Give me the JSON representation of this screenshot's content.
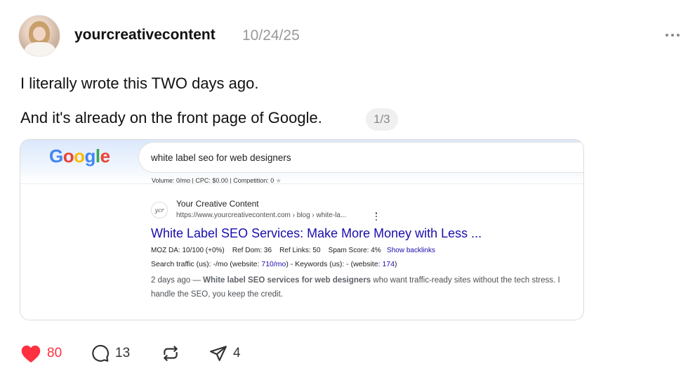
{
  "post": {
    "username": "yourcreativecontent",
    "timestamp": "10/24/25",
    "text_line1": "I literally wrote this TWO days ago.",
    "text_line2": "And it's already on the front page of Google.",
    "pager": "1/3"
  },
  "screenshot": {
    "logo_letters": [
      "G",
      "o",
      "o",
      "g",
      "l",
      "e"
    ],
    "search_query": "white label seo for web designers",
    "metrics": "Volume: 0/mo | CPC: $0.00 | Competition: 0",
    "result": {
      "favicon_text": "ycr",
      "site_name": "Your Creative Content",
      "site_url": "https://www.yourcreativecontent.com › blog › white-la...",
      "title": "White Label SEO Services: Make More Money with Less ...",
      "moz_da": "MOZ DA: 10/100 (+0%)",
      "ref_dom": "Ref Dom: 36",
      "ref_links": "Ref Links: 50",
      "spam_score": "Spam Score: 4%",
      "show_backlinks": "Show backlinks",
      "traffic_prefix": "Search traffic (us): -/mo (website: ",
      "traffic_website": "710/mo",
      "traffic_mid": ") - Keywords (us): - (website: ",
      "traffic_keywords": "174",
      "traffic_suffix": ")",
      "snippet_date": "2 days ago — ",
      "snippet_bold": "White label SEO services for web designers",
      "snippet_rest": " who want traffic-ready sites without the tech stress. I handle the SEO, you keep the credit."
    }
  },
  "actions": {
    "likes": "80",
    "comments": "13",
    "shares": "4"
  },
  "colors": {
    "like": "#ff3040",
    "link_blue": "#1a0dab",
    "muted": "#999999"
  },
  "icons": [
    "heart-icon",
    "comment-icon",
    "repost-icon",
    "share-icon",
    "more-icon"
  ]
}
